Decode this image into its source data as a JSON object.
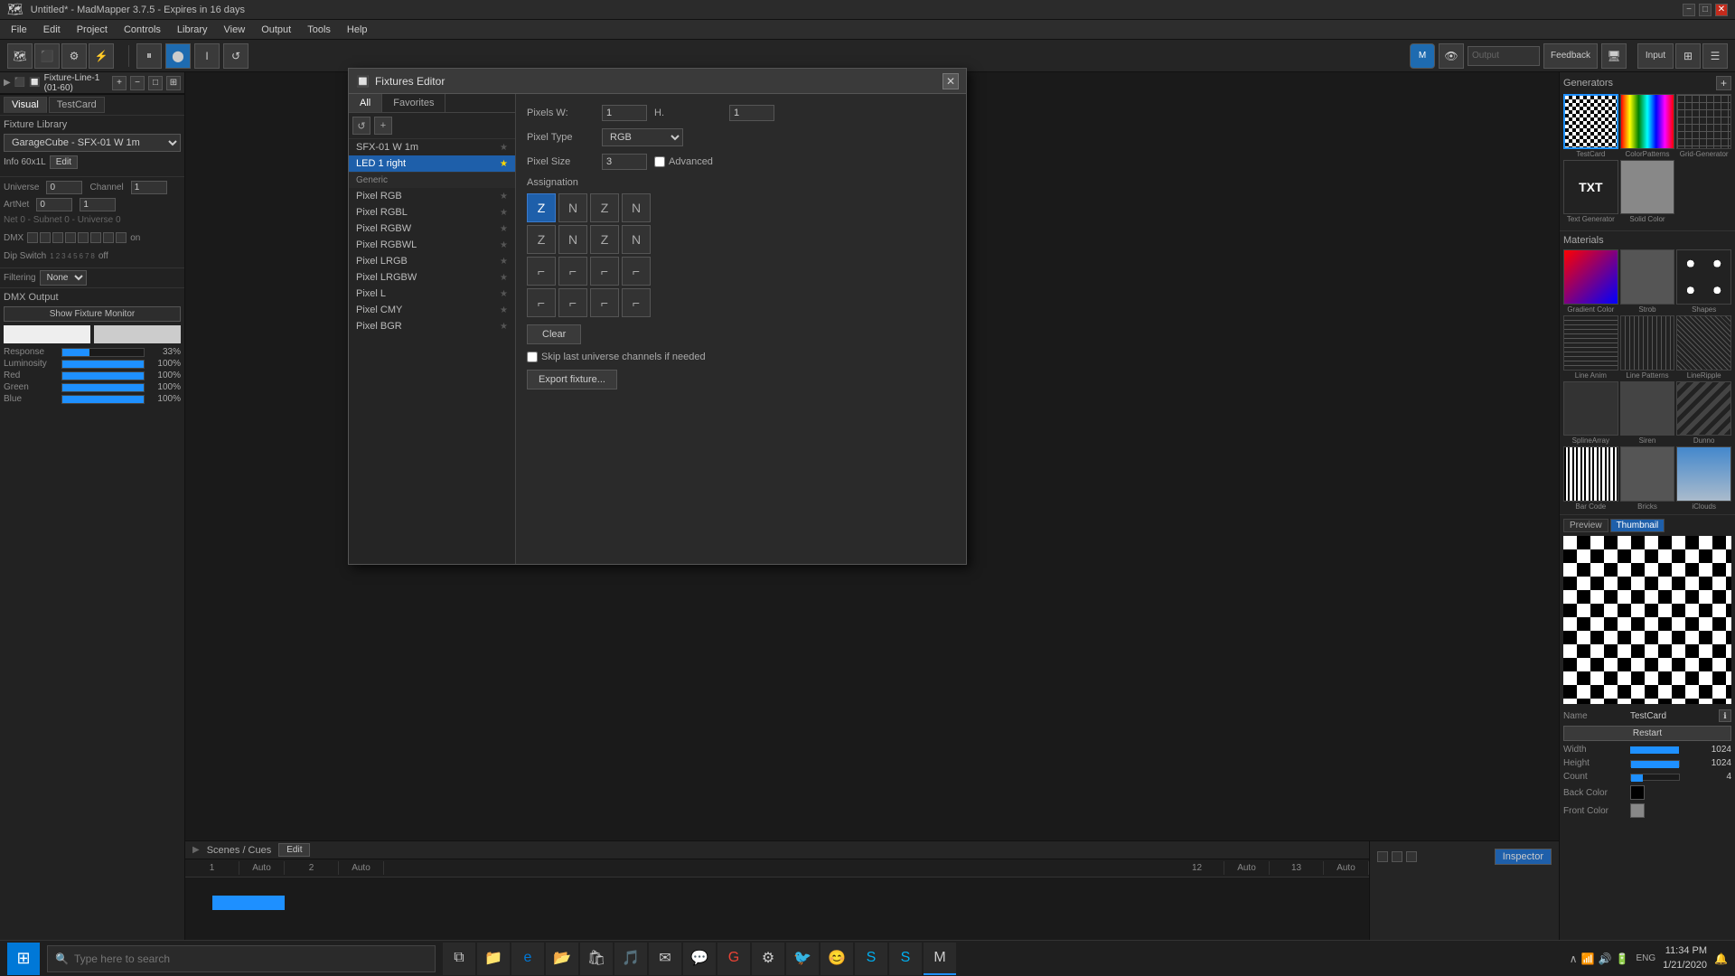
{
  "titlebar": {
    "title": "Untitled* - MadMapper 3.7.5 - Expires in 16 days",
    "minimize": "−",
    "maximize": "□",
    "close": "✕"
  },
  "menubar": {
    "items": [
      "File",
      "Edit",
      "Project",
      "Controls",
      "Library",
      "View",
      "Output",
      "Tools",
      "Help"
    ]
  },
  "toolbar": {
    "transport": [
      "⏸",
      "⬤",
      "I",
      "↺"
    ]
  },
  "fixtures_editor": {
    "title": "Fixtures Editor",
    "close": "✕",
    "tabs": [
      "All",
      "Favorites"
    ],
    "fixture_list": [
      {
        "name": "SFX-01 W 1m",
        "category": false,
        "selected": false
      },
      {
        "name": "LED 1 right",
        "category": false,
        "selected": true
      },
      {
        "name": "Generic",
        "category": true
      },
      {
        "name": "Pixel RGB",
        "category": false,
        "selected": false
      },
      {
        "name": "Pixel RGBL",
        "category": false,
        "selected": false
      },
      {
        "name": "Pixel RGBW",
        "category": false,
        "selected": false
      },
      {
        "name": "Pixel RGBWL",
        "category": false,
        "selected": false
      },
      {
        "name": "Pixel LRGB",
        "category": false,
        "selected": false
      },
      {
        "name": "Pixel LRGBW",
        "category": false,
        "selected": false
      },
      {
        "name": "Pixel L",
        "category": false,
        "selected": false
      },
      {
        "name": "Pixel CMY",
        "category": false,
        "selected": false
      },
      {
        "name": "Pixel BGR",
        "category": false,
        "selected": false
      }
    ],
    "pixels_w_label": "Pixels W:",
    "pixels_w_value": "1",
    "pixels_h_label": "H.",
    "pixels_h_value": "1",
    "pixel_type_label": "Pixel Type",
    "pixel_type_value": "RGB",
    "pixel_size_label": "Pixel Size",
    "pixel_size_value": "3",
    "advanced_label": "Advanced",
    "assignation_label": "Assignation",
    "clear_label": "Clear",
    "skip_last_label": "Skip last universe channels if needed",
    "export_label": "Export fixture..."
  },
  "left_panel": {
    "layer_name": "Fixture-Line-1 (01-60)",
    "view_tabs": [
      "Visual",
      "TestCard"
    ],
    "fixture_library": {
      "title": "Fixture Library",
      "selected": "GarageCube - SFX-01 W 1m",
      "info": "Info  60x1L",
      "edit": "Edit"
    },
    "universe": {
      "label": "Universe",
      "value": "0",
      "channel_label": "Channel",
      "channel_value": "1",
      "art_net_label": "ArtNet",
      "art_net_value": "0",
      "subnet_info": "Net 0 - Subnet 0 - Universe 0"
    },
    "filtering": {
      "label": "Filtering",
      "value": "None"
    },
    "dmx_output": {
      "title": "DMX Output",
      "show_fixture_btn": "Show Fixture Monitor",
      "sliders": [
        {
          "label": "Response",
          "value": 33,
          "display": "33%"
        },
        {
          "label": "Luminosity",
          "value": 100,
          "display": "100%"
        },
        {
          "label": "Red",
          "value": 100,
          "display": "100%"
        },
        {
          "label": "Green",
          "value": 100,
          "display": "100%"
        },
        {
          "label": "Blue",
          "value": 100,
          "display": "100%"
        }
      ]
    }
  },
  "right_panel": {
    "generators": {
      "title": "Generators",
      "items": [
        {
          "name": "TestCard",
          "type": "checker"
        },
        {
          "name": "ColorPatterns",
          "type": "gradient"
        },
        {
          "name": "Grid-Generator",
          "type": "grid"
        },
        {
          "name": "Text Generator",
          "type": "txt"
        },
        {
          "name": "Solid Color",
          "type": "solid"
        }
      ]
    },
    "materials": {
      "title": "Materials",
      "items": [
        {
          "name": "Gradient Color",
          "type": "gradient-mat"
        },
        {
          "name": "Strob",
          "type": "strob"
        },
        {
          "name": "Shapes",
          "type": "shapes"
        },
        {
          "name": "Line Anim",
          "type": "line-anim"
        },
        {
          "name": "Line Patterns",
          "type": "line-pat"
        },
        {
          "name": "LineRipple",
          "type": "line-ripple"
        },
        {
          "name": "SplineArray",
          "type": "spline"
        },
        {
          "name": "Siren",
          "type": "siren"
        },
        {
          "name": "Dunno",
          "type": "dunno"
        },
        {
          "name": "Bar Code",
          "type": "barcode"
        },
        {
          "name": "Bricks",
          "type": "bricks"
        },
        {
          "name": "iClouds",
          "type": "clouds"
        }
      ]
    },
    "preview": {
      "title": "Preview",
      "thumbnail_label": "Thumbnail",
      "tabs": [
        "Preview",
        "Thumbnail"
      ],
      "name_label": "Name",
      "name_value": "TestCard",
      "restart_label": "Restart",
      "width_label": "Width",
      "width_value": "1024",
      "height_label": "Height",
      "height_value": "1024",
      "count_label": "Count",
      "count_value": "4",
      "back_color_label": "Back Color",
      "front_color_label": "Front Color"
    }
  },
  "bottom": {
    "scenes_title": "Scenes / Cues",
    "edit_label": "Edit",
    "scene_cols": [
      {
        "num": "1",
        "type": "Auto"
      },
      {
        "num": "2",
        "type": "Auto"
      },
      {
        "num": "12",
        "type": "Auto"
      },
      {
        "num": "13",
        "type": "Auto"
      }
    ],
    "inspector_label": "Inspector"
  },
  "taskbar": {
    "search_placeholder": "Type here to search",
    "time": "11:34 PM",
    "date": "1/21/2020",
    "lang": "ENG"
  }
}
